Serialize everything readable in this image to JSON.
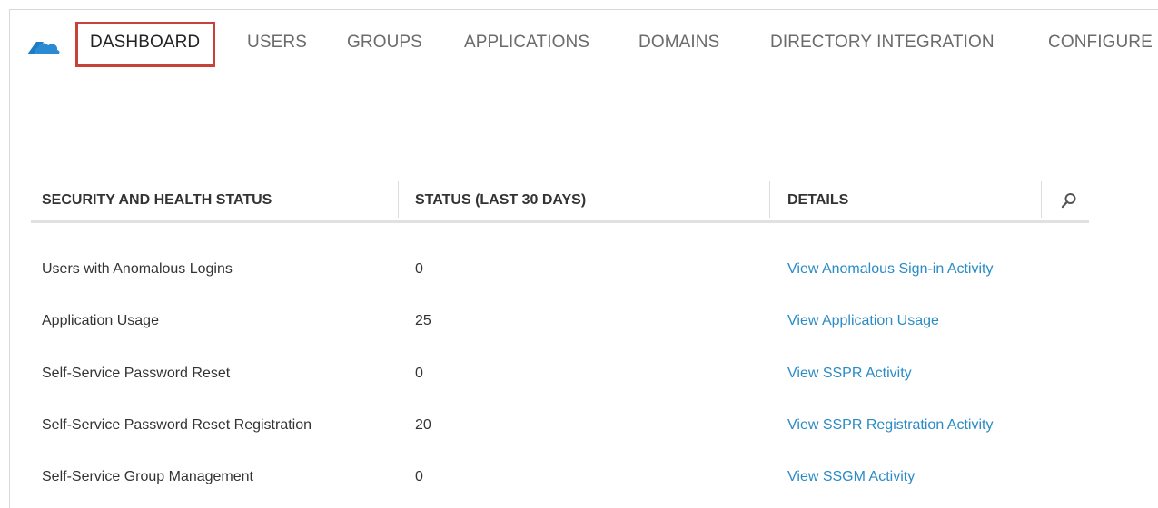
{
  "nav": {
    "tabs": [
      {
        "label": "DASHBOARD",
        "active": true
      },
      {
        "label": "USERS"
      },
      {
        "label": "GROUPS"
      },
      {
        "label": "APPLICATIONS"
      },
      {
        "label": "DOMAINS"
      },
      {
        "label": "DIRECTORY INTEGRATION"
      },
      {
        "label": "CONFIGURE"
      }
    ],
    "logo_icon": "azure-cloud-icon"
  },
  "table": {
    "headers": {
      "status": "SECURITY AND HEALTH STATUS",
      "count": "STATUS (LAST 30 DAYS)",
      "details": "DETAILS"
    },
    "search_icon": "search-icon",
    "rows": [
      {
        "name": "Users with Anomalous Logins",
        "count": "0",
        "link": "View Anomalous Sign-in Activity"
      },
      {
        "name": "Application Usage",
        "count": "25",
        "link": "View Application Usage"
      },
      {
        "name": "Self-Service Password Reset",
        "count": "0",
        "link": "View SSPR Activity"
      },
      {
        "name": "Self-Service Password Reset Registration",
        "count": "20",
        "link": "View SSPR Registration Activity"
      },
      {
        "name": "Self-Service Group Management",
        "count": "0",
        "link": "View SSGM Activity"
      }
    ]
  },
  "colors": {
    "link": "#2a8bc5",
    "highlight": "#c8423a",
    "logo": "#1e7bc4"
  }
}
